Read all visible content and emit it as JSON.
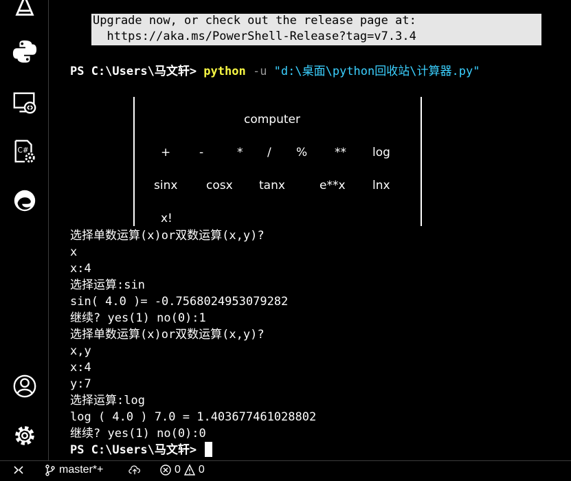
{
  "activity_bar": {
    "icons": [
      "explorer-icon",
      "python-icon",
      "remote-explorer-icon",
      "extension-settings-icon",
      "edge-devtools-icon",
      "account-icon",
      "settings-gear-icon"
    ]
  },
  "terminal": {
    "notice": {
      "line1": "Upgrade now, or check out the release page at:",
      "line2": "  https://aka.ms/PowerShell-Release?tag=v7.3.4"
    },
    "command": {
      "prompt": "PS C:\\Users\\马文轩> ",
      "exe": "python",
      "flag": " -u ",
      "arg": "\"d:\\桌面\\python回收站\\计算器.py\""
    },
    "menu": {
      "title": "computer",
      "row1": [
        "+",
        "-",
        "*",
        "/",
        "%",
        "**",
        "log"
      ],
      "row2": [
        "sinx",
        "cosx",
        "tanx",
        "e**x",
        "lnx"
      ],
      "row3": [
        "x!"
      ]
    },
    "output": [
      "选择单数运算(x)or双数运算(x,y)?",
      "x",
      "x:4",
      "选择运算:sin",
      "sin( 4.0 )= -0.7568024953079282",
      "继续? yes(1) no(0):1",
      "选择单数运算(x)or双数运算(x,y)?",
      "x,y",
      "x:4",
      "y:7",
      "选择运算:log",
      "log ( 4.0 ) 7.0 = 1.403677461028802",
      "继续? yes(1) no(0):0"
    ],
    "final_prompt": "PS C:\\Users\\马文轩> "
  },
  "status_bar": {
    "remote_icon": "remote-icon",
    "branch": "master*+",
    "sync_icon": "sync-cloud-icon",
    "errors": "0",
    "warnings": "0"
  }
}
